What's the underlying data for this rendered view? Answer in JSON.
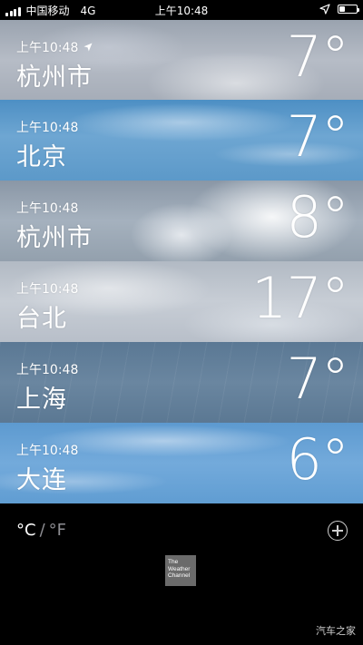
{
  "status_bar": {
    "carrier": "中国移动",
    "network": "4G",
    "time": "上午10:48",
    "battery_level": 0.35
  },
  "cities": [
    {
      "time": "上午10:48",
      "city": "杭州市",
      "temp": "7°",
      "current_location": true,
      "background": "cloudy"
    },
    {
      "time": "上午10:48",
      "city": "北京",
      "temp": "7°",
      "current_location": false,
      "background": "blue"
    },
    {
      "time": "上午10:48",
      "city": "杭州市",
      "temp": "8°",
      "current_location": false,
      "background": "cloud-big"
    },
    {
      "time": "上午10:48",
      "city": "台北",
      "temp": "17°",
      "current_location": false,
      "background": "light"
    },
    {
      "time": "上午10:48",
      "city": "上海",
      "temp": "7°",
      "current_location": false,
      "background": "rain"
    },
    {
      "time": "上午10:48",
      "city": "大连",
      "temp": "6°",
      "current_location": false,
      "background": "sky"
    }
  ],
  "footer": {
    "unit_c": "°C",
    "unit_sep": "/",
    "unit_f": "°F",
    "logo_line1": "The",
    "logo_line2": "Weather",
    "logo_line3": "Channel"
  },
  "watermark": "汽车之家",
  "icons": {
    "location": "location-arrow-icon",
    "add": "plus-circle-icon"
  }
}
